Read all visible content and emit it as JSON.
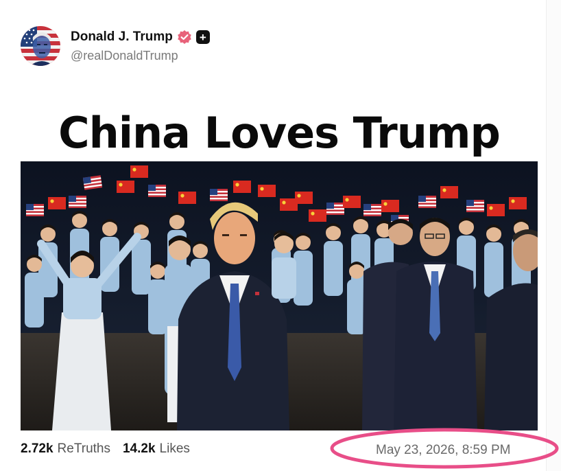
{
  "author": {
    "display_name": "Donald J. Trump",
    "handle": "@realDonaldTrump",
    "verified_icon": "verified-badge-icon",
    "follow_icon": "plus-icon"
  },
  "post": {
    "image_caption": "China Loves Trump"
  },
  "stats": {
    "retruths_value": "2.72k",
    "retruths_label": "ReTruths",
    "likes_value": "14.2k",
    "likes_label": "Likes"
  },
  "timestamp": "May 23, 2026, 8:59 PM",
  "colors": {
    "verified_badge": "#e8627a",
    "highlight_ring": "#e84e88",
    "name_text": "#111111",
    "muted_text": "#7a7a7a"
  }
}
